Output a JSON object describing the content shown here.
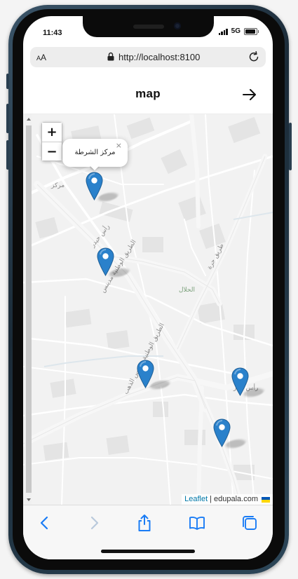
{
  "status_bar": {
    "time": "11:43",
    "network": "5G"
  },
  "browser": {
    "text_size_label_small": "A",
    "text_size_label_large": "A",
    "url": "http://localhost:8100"
  },
  "app_header": {
    "title": "map"
  },
  "map": {
    "zoom_in_label": "+",
    "zoom_out_label": "−",
    "popup": {
      "text": "مركز الشرطة",
      "close_label": "×"
    },
    "street_labels": [
      "طريق حرة",
      "الحلال",
      "الطريق الوطنية مدينس",
      "الطريق الوطنية مدينس الذهب",
      "مركز",
      "رأس حيدر",
      "رأس حذر"
    ],
    "marker_count": 5,
    "marker_color": "#2A81CB",
    "attribution": {
      "leaflet_label": "Leaflet",
      "separator": "|",
      "source": "edupala.com"
    }
  },
  "toolbar": {
    "icons": [
      "back-icon",
      "forward-icon",
      "share-icon",
      "bookmarks-icon",
      "tabs-icon"
    ],
    "accent_color": "#1a7cf5",
    "disabled_color": "#b9c9dc"
  }
}
